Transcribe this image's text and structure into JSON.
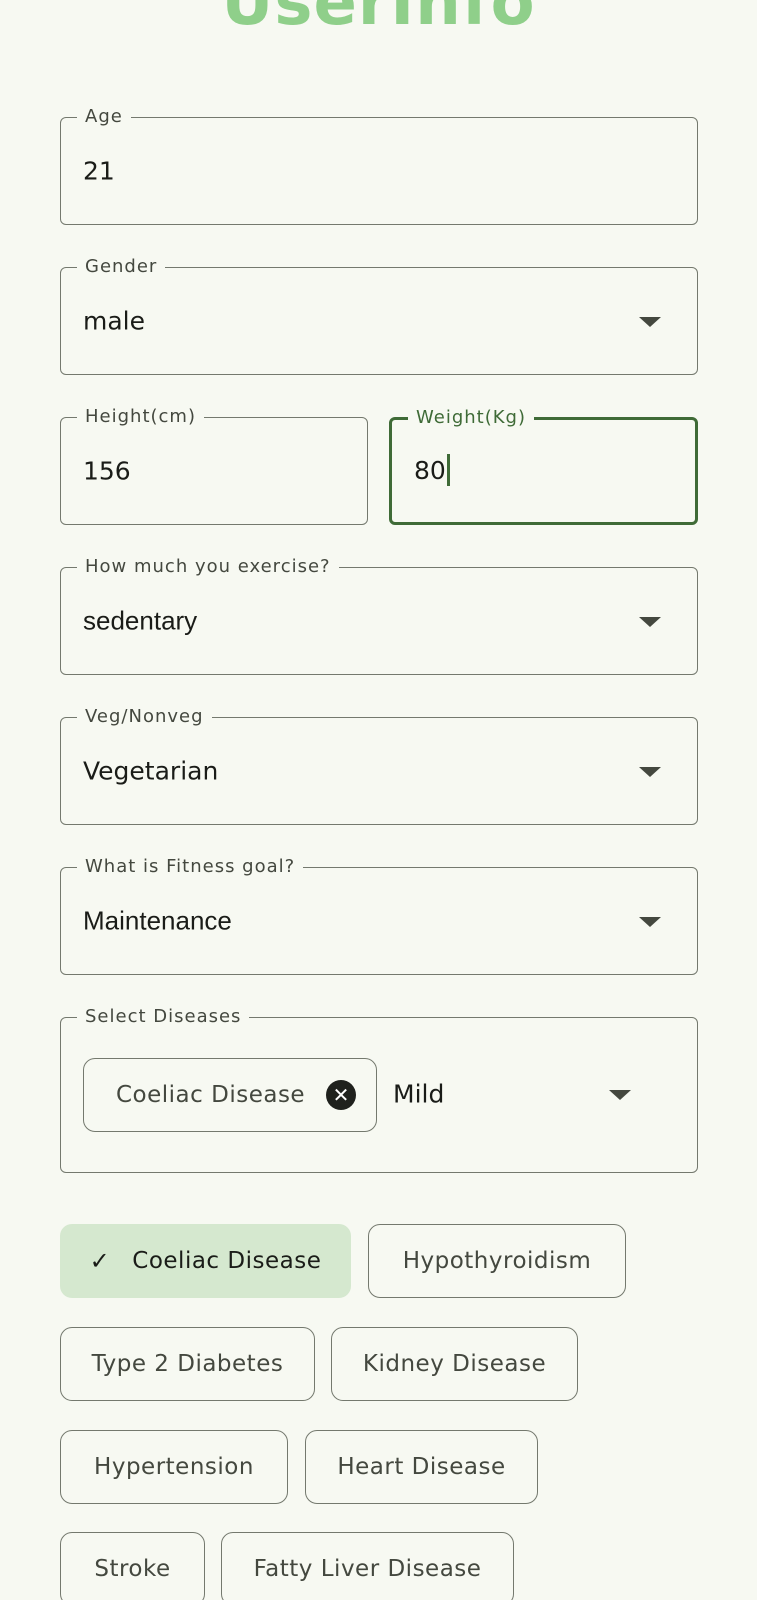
{
  "header": {
    "title": "UserInfo"
  },
  "form": {
    "age": {
      "label": "Age",
      "value": "21"
    },
    "gender": {
      "label": "Gender",
      "value": "male"
    },
    "height": {
      "label": "Height(cm)",
      "value": "156"
    },
    "weight": {
      "label": "Weight(Kg)",
      "value": "80"
    },
    "exercise": {
      "label": "How much you exercise?",
      "value": "sedentary"
    },
    "diet": {
      "label": "Veg/Nonveg",
      "value": "Vegetarian"
    },
    "goal": {
      "label": "What is Fitness goal?",
      "value": "Maintenance"
    },
    "diseases": {
      "label": "Select Diseases",
      "selected_chip": "Coeliac Disease",
      "severity": "Mild"
    }
  },
  "disease_chips": [
    {
      "label": "Coeliac Disease",
      "selected": true
    },
    {
      "label": "Hypothyroidism",
      "selected": false
    },
    {
      "label": "Type 2 Diabetes",
      "selected": false
    },
    {
      "label": "Kidney Disease",
      "selected": false
    },
    {
      "label": "Hypertension",
      "selected": false
    },
    {
      "label": "Heart Disease",
      "selected": false
    },
    {
      "label": "Stroke",
      "selected": false
    },
    {
      "label": "Fatty Liver Disease",
      "selected": false
    }
  ],
  "colors": {
    "accent": "#3f6b37",
    "title": "#8fcf8a",
    "selected_chip_bg": "#d5e8cf",
    "background": "#f7f9f2"
  },
  "icons": {
    "dropdown": "dropdown-arrow-icon",
    "check": "check-icon",
    "close": "close-circle-icon"
  }
}
